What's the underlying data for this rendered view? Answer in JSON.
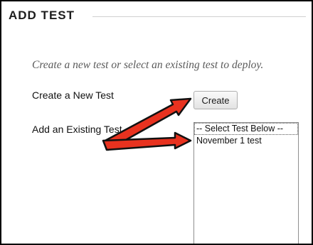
{
  "section": {
    "title": "ADD TEST"
  },
  "instructions": "Create a new test or select an existing test to deploy.",
  "create_new": {
    "label": "Create a New Test",
    "button_label": "Create"
  },
  "add_existing": {
    "label": "Add an Existing Test",
    "options": [
      "-- Select Test Below --",
      "November 1 test"
    ]
  },
  "annotation": {
    "arrow_color": "#e8321f",
    "arrow_outline": "#111111",
    "arrow_icon": "red-arrow-icon"
  }
}
